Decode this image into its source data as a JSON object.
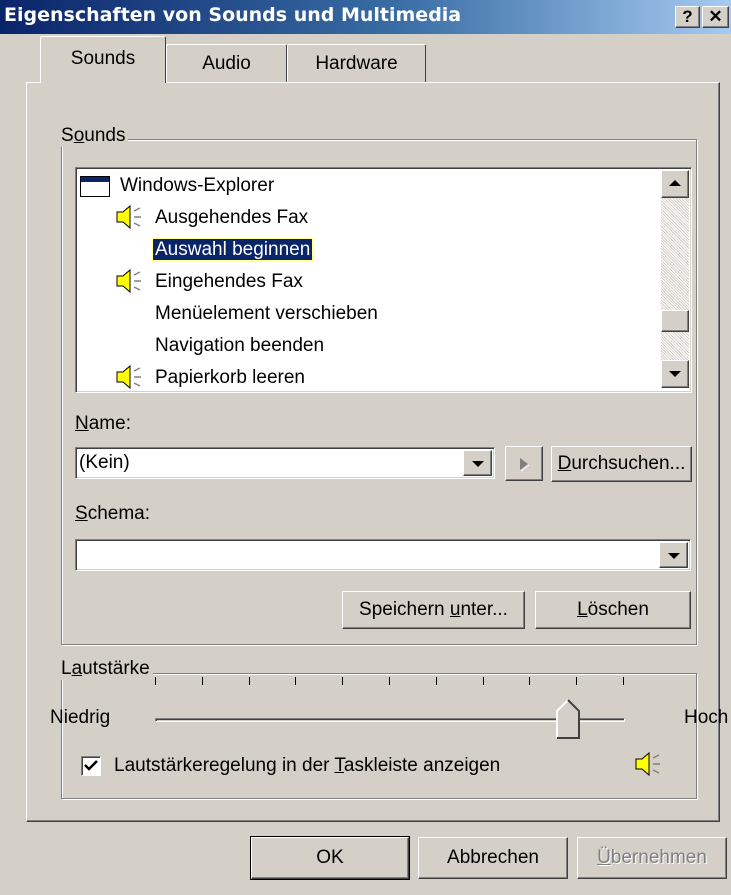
{
  "window": {
    "title": "Eigenschaften von Sounds und Multimedia",
    "help_label": "?",
    "close_label": "✕"
  },
  "tabs": [
    {
      "label": "Sounds",
      "active": true
    },
    {
      "label": "Audio",
      "active": false
    },
    {
      "label": "Hardware",
      "active": false
    }
  ],
  "sounds_group": {
    "label_pre": "S",
    "label_accel": "o",
    "label_post": "unds",
    "events": [
      {
        "label": "Windows-Explorer",
        "icon": "window-icon",
        "selected": false
      },
      {
        "label": "Ausgehendes Fax",
        "icon": "speaker-icon",
        "selected": false
      },
      {
        "label": "Auswahl beginnen",
        "icon": "",
        "selected": true
      },
      {
        "label": "Eingehendes Fax",
        "icon": "speaker-icon",
        "selected": false
      },
      {
        "label": "Menüelement verschieben",
        "icon": "",
        "selected": false
      },
      {
        "label": "Navigation beenden",
        "icon": "",
        "selected": false
      },
      {
        "label": "Papierkorb leeren",
        "icon": "speaker-icon",
        "selected": false
      }
    ],
    "name_label_accel": "N",
    "name_label_post": "ame:",
    "name_value": "(Kein)",
    "browse_accel": "D",
    "browse_post": "urchsuchen...",
    "schema_label_accel": "S",
    "schema_label_post": "chema:",
    "schema_value": "",
    "save_as_pre": "Speichern ",
    "save_as_accel": "u",
    "save_as_post": "nter...",
    "delete_accel": "L",
    "delete_post": "öschen"
  },
  "volume_group": {
    "label_pre": "L",
    "label_accel": "a",
    "label_post": "utstärke",
    "low_label": "Niedrig",
    "high_label": "Hoch",
    "level": 0.9,
    "checkbox_checked": true,
    "checkbox_pre": "Lautstärkeregelung in der ",
    "checkbox_accel": "T",
    "checkbox_post": "askleiste anzeigen"
  },
  "buttons": {
    "ok": "OK",
    "cancel": "Abbrechen",
    "apply_accel": "Ü",
    "apply_post": "bernehmen"
  }
}
